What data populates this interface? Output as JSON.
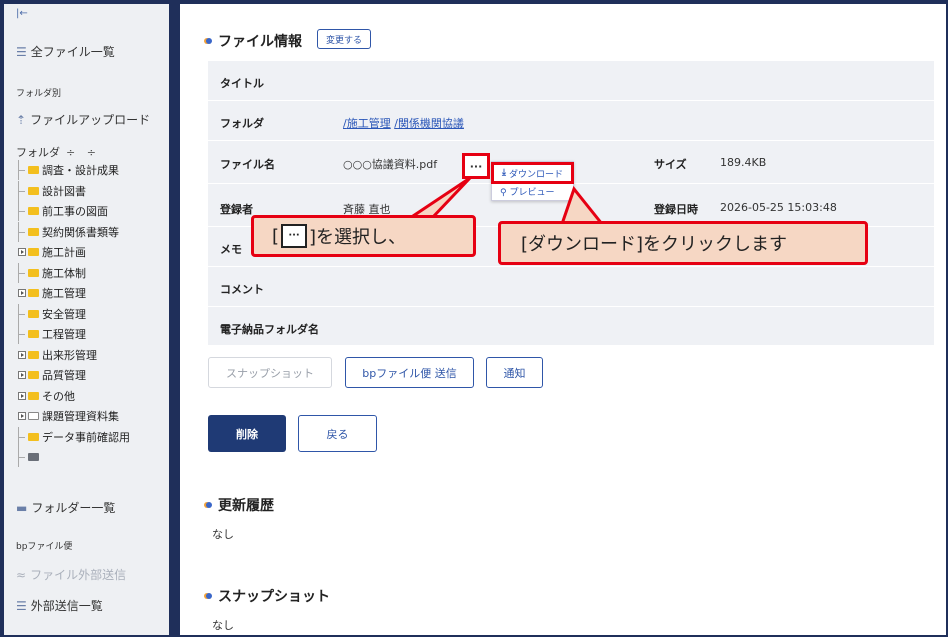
{
  "sidebar": {
    "collapse_label": "|←",
    "all_files": "全ファイル一覧",
    "by_folder": "フォルダ別",
    "upload": "ファイルアップロード",
    "folder_label": "フォルダ",
    "sort_label": "÷ ÷",
    "tree": [
      {
        "label": "調査・設計成果",
        "exp": false
      },
      {
        "label": "設計図書",
        "exp": false
      },
      {
        "label": "前工事の図面",
        "exp": false
      },
      {
        "label": "契約関係書類等",
        "exp": false
      },
      {
        "label": "施工計画",
        "exp": true
      },
      {
        "label": "施工体制",
        "exp": false
      },
      {
        "label": "施工管理",
        "exp": true
      },
      {
        "label": "安全管理",
        "exp": false
      },
      {
        "label": "工程管理",
        "exp": false
      },
      {
        "label": "出来形管理",
        "exp": true
      },
      {
        "label": "品質管理",
        "exp": true
      },
      {
        "label": "その他",
        "exp": true
      },
      {
        "label": "課題管理資料集",
        "exp": true
      },
      {
        "label": "データ事前確認用",
        "exp": false
      }
    ],
    "folder_list": "フォルダー一覧",
    "bp_header": "bpファイル便",
    "external_send": "ファイル外部送信",
    "external_list": "外部送信一覧"
  },
  "file_info": {
    "title": "ファイル情報",
    "change_button": "変更する",
    "rows": {
      "title_label": "タイトル",
      "folder_label": "フォルダ",
      "folder_path_sep": "/",
      "folder_path_1": "施工管理",
      "folder_path_2": "関係機関協議",
      "filename_label": "ファイル名",
      "filename_value": "○○○協議資料.pdf",
      "size_label": "サイズ",
      "size_value": "189.4KB",
      "registrant_label": "登録者",
      "registrant_value": "斉藤 直也",
      "registered_date_label": "登録日時",
      "registered_date_value": "2026-05-25 15:03:48",
      "memo_label": "メモ",
      "comment_label": "コメント",
      "electronic_folder_label": "電子納品フォルダ名"
    },
    "dots_button": "···",
    "menu": {
      "download": "ダウンロード",
      "preview": "プレビュー"
    }
  },
  "actions": {
    "snapshot": "スナップショット",
    "bp_send": "bpファイル便 送信",
    "notify": "通知",
    "delete": "削除",
    "back": "戻る"
  },
  "history": {
    "title": "更新履歴",
    "value": "なし"
  },
  "snapshot_section": {
    "title": "スナップショット",
    "value": "なし"
  },
  "callouts": {
    "left_prefix": "[",
    "left_key": "···",
    "left_suffix": "]を選択し、",
    "right": "[ダウンロード]をクリックします"
  },
  "colors": {
    "accent": "#1f3a75",
    "link": "#2a56b8",
    "highlight_red": "#e60012",
    "callout_bg": "#f6d7c4",
    "folder_yellow": "#f3bf1e"
  }
}
